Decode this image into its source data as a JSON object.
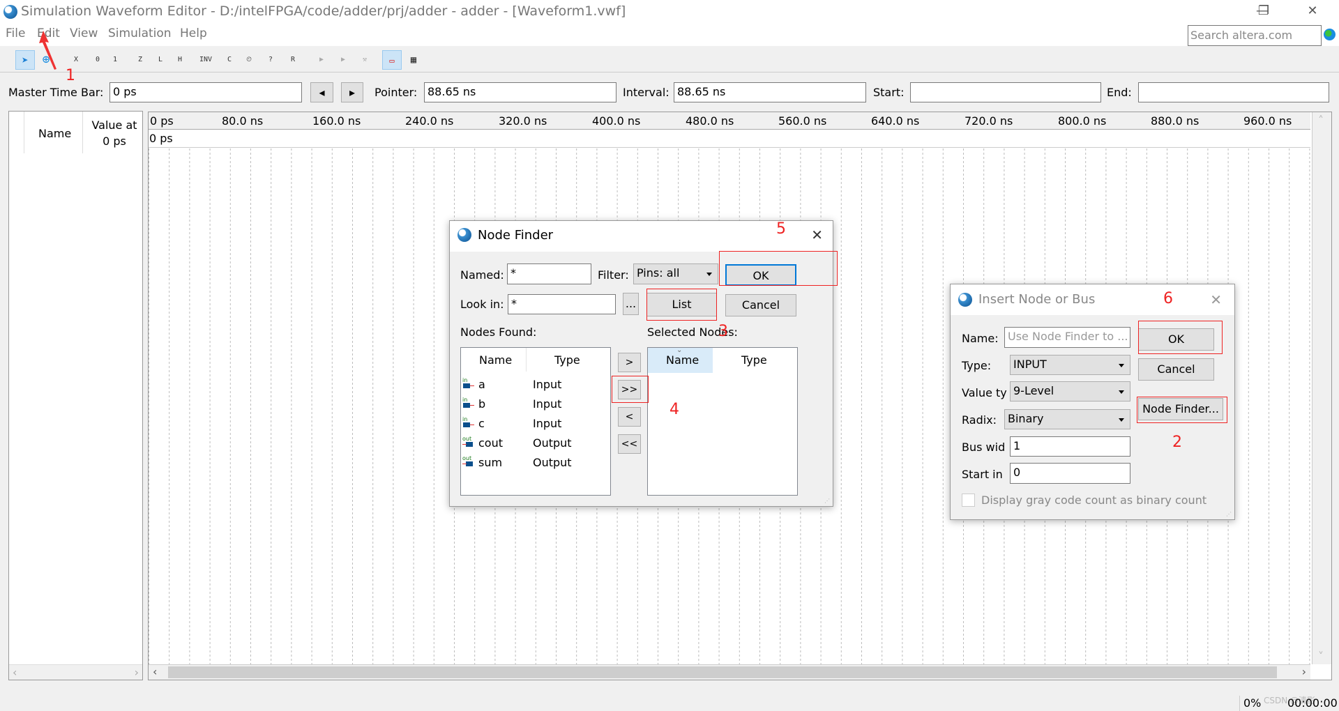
{
  "window": {
    "title": "Simulation Waveform Editor - D:/intelFPGA/code/adder/prj/adder - adder - [Waveform1.vwf]",
    "minimize": "—",
    "restore": "❐",
    "close": "✕"
  },
  "menu": [
    "File",
    "Edit",
    "View",
    "Simulation",
    "Help"
  ],
  "search": {
    "placeholder": "Search altera.com"
  },
  "toolbar": {
    "icons": [
      "select-pointer",
      "zoom",
      "forcing-unknown",
      "forcing-low",
      "forcing-high",
      "high-impedance",
      "weak-low",
      "weak-high",
      "invert",
      "count-value",
      "clock",
      "arbitrary-value",
      "random-value",
      "run-functional",
      "run-timing",
      "generate-netlist",
      "snap-to-grid",
      "grid-settings"
    ],
    "glyphs": [
      "➤",
      "⊕",
      "X",
      "0",
      "1",
      "Z",
      "L",
      "H",
      "INV",
      "C",
      "⏲",
      "?",
      "R",
      "▶",
      "▶",
      "⚒",
      "▭",
      "▦"
    ]
  },
  "timebar": {
    "master_label": "Master Time Bar:",
    "master_value": "0 ps",
    "prev": "◂",
    "next": "▸",
    "pointer_label": "Pointer:",
    "pointer_value": "88.65 ns",
    "interval_label": "Interval:",
    "interval_value": "88.65 ns",
    "start_label": "Start:",
    "start_value": "",
    "end_label": "End:",
    "end_value": ""
  },
  "nodes_panel": {
    "name_header": "Name",
    "value_header_1": "Value at",
    "value_header_2": "0 ps"
  },
  "waveform": {
    "ticks": [
      "0 ps",
      "80.0 ns",
      "160.0 ns",
      "240.0 ns",
      "320.0 ns",
      "400.0 ns",
      "480.0 ns",
      "560.0 ns",
      "640.0 ns",
      "720.0 ns",
      "800.0 ns",
      "880.0 ns",
      "960.0 ns"
    ],
    "cursor_label": "0 ps"
  },
  "node_finder": {
    "title": "Node Finder",
    "named_label": "Named:",
    "named_value": "*",
    "filter_label": "Filter:",
    "filter_value": "Pins: all",
    "ok": "OK",
    "look_in_label": "Look in:",
    "look_in_value": "*",
    "browse": "...",
    "list": "List",
    "cancel": "Cancel",
    "nodes_found_label": "Nodes Found:",
    "selected_nodes_label": "Selected Nodes:",
    "col_name": "Name",
    "col_type": "Type",
    "nodes": [
      {
        "name": "a",
        "type": "Input",
        "dir": "in"
      },
      {
        "name": "b",
        "type": "Input",
        "dir": "in"
      },
      {
        "name": "c",
        "type": "Input",
        "dir": "in"
      },
      {
        "name": "cout",
        "type": "Output",
        "dir": "out"
      },
      {
        "name": "sum",
        "type": "Output",
        "dir": "out"
      }
    ],
    "move_one": ">",
    "move_all": ">>",
    "remove_one": "<",
    "remove_all": "<<"
  },
  "insert_node": {
    "title": "Insert Node or Bus",
    "name_label": "Name:",
    "name_placeholder": "Use Node Finder to ...",
    "type_label": "Type:",
    "type_value": "INPUT",
    "value_type_label": "Value ty",
    "value_type_value": "9-Level",
    "radix_label": "Radix:",
    "radix_value": "Binary",
    "bus_width_label": "Bus wid",
    "bus_width_value": "1",
    "start_index_label": "Start in",
    "start_index_value": "0",
    "gray_code_label": "Display gray code count as binary count",
    "gray_code_checked": false,
    "ok": "OK",
    "cancel": "Cancel",
    "node_finder": "Node Finder..."
  },
  "annotations": [
    "1",
    "2",
    "3",
    "4",
    "5",
    "6"
  ],
  "status": {
    "progress": "0%",
    "time": "00:00:00",
    "watermark": "CSDN @清影"
  }
}
